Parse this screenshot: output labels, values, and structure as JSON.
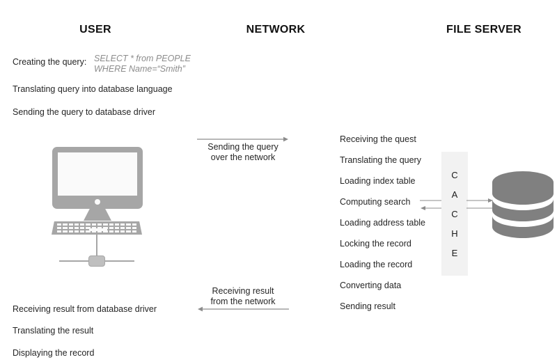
{
  "columns": {
    "user": "USER",
    "network": "NETWORK",
    "file_server": "FILE SERVER"
  },
  "user_flow": {
    "creating_label": "Creating the query:",
    "query_line1": "SELECT * from PEOPLE",
    "query_line2": "WHERE Name=“Smith”",
    "steps_top": [
      "Translating query into database language",
      "Sending the query to database driver"
    ],
    "steps_bottom": [
      "Receiving result from database driver",
      "Translating the result",
      "Displaying the record"
    ]
  },
  "network_flow": {
    "outbound_label_line1": "Sending the query",
    "outbound_label_line2": "over the network",
    "inbound_label_line1": "Receiving result",
    "inbound_label_line2": "from the network"
  },
  "server_flow": {
    "steps": [
      "Receiving the quest",
      "Translating the query",
      "Loading index table",
      "Computing search",
      "Loading address table",
      "Locking the record",
      "Loading the record",
      "Converting data",
      "Sending result"
    ]
  },
  "cache": {
    "letters": [
      "C",
      "A",
      "C",
      "H",
      "E"
    ]
  },
  "colors": {
    "device_gray": "#a6a6a6",
    "database_gray": "#808080",
    "cache_fill": "#f2f2f2",
    "arrow_gray": "#808080",
    "text_dark": "#262626",
    "query_gray": "#8c8c8c"
  },
  "icons": {
    "computer": "desktop-computer-icon",
    "database": "database-cylinder-icon",
    "network_node": "network-node-icon"
  }
}
